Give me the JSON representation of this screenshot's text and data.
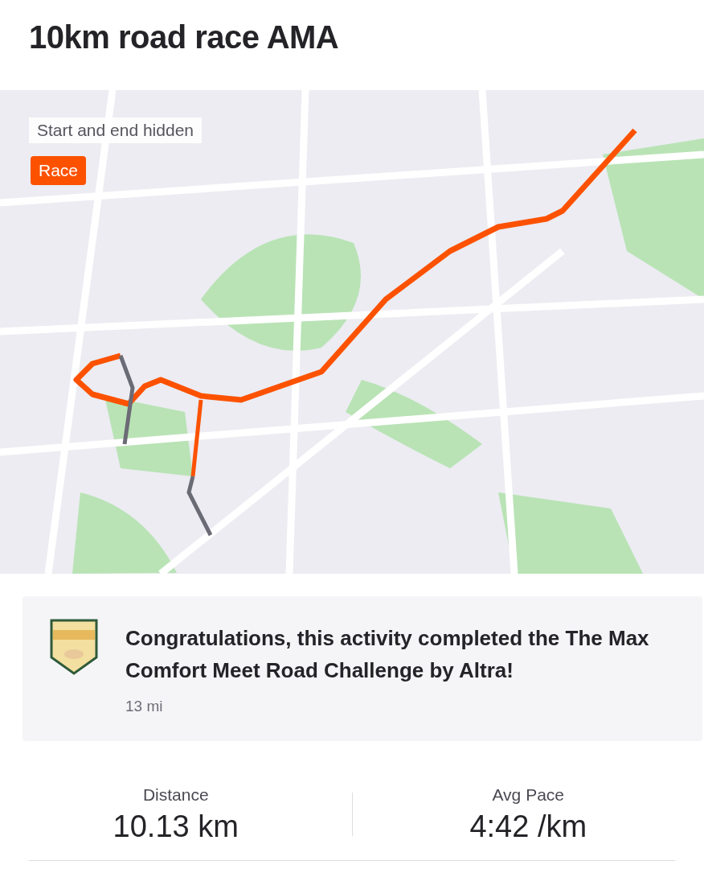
{
  "title": "10km road race AMA",
  "map": {
    "kind": "picture",
    "privacy_note": "Start and end hidden",
    "tag": "Race"
  },
  "achievement": {
    "message": "Congratulations, this activity completed the The Max Comfort Meet Road Challenge by Altra!",
    "detail": "13 mi"
  },
  "stats": [
    {
      "label": "Distance",
      "value": "10.13 km"
    },
    {
      "label": "Avg Pace",
      "value": "4:42 /km"
    }
  ]
}
